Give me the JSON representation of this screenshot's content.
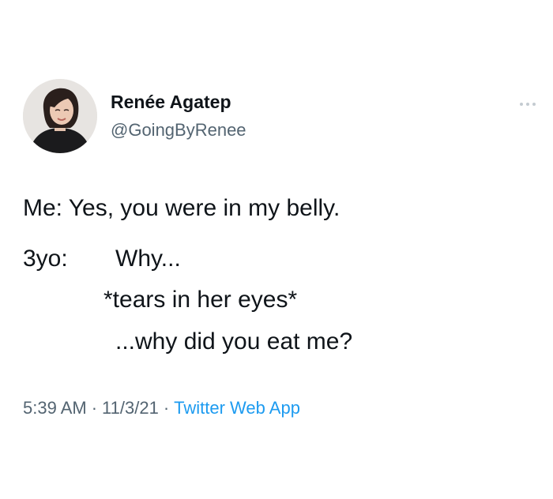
{
  "tweet": {
    "author": {
      "display_name": "Renée Agatep",
      "handle": "@GoingByRenee",
      "avatar_icon": "profile-photo"
    },
    "more_icon": "more-horizontal-icon",
    "lines": {
      "line1": "Me: Yes, you were in my belly.",
      "speaker2": "3yo:",
      "line2": "Why...",
      "line3": "*tears in her eyes*",
      "line4": "...why did you eat me?"
    },
    "meta": {
      "time": "5:39 AM",
      "separator": "·",
      "date": "11/3/21",
      "source": "Twitter Web App"
    },
    "colors": {
      "text": "#0f1419",
      "secondary": "#536471",
      "link": "#1d9bf0"
    }
  }
}
